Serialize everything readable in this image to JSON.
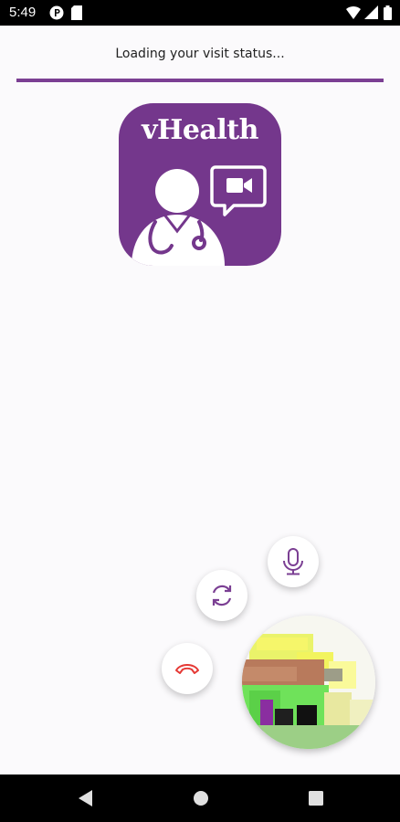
{
  "status_bar": {
    "time": "5:49",
    "icons": [
      "notification-p-icon",
      "sim-card-icon",
      "wifi-icon",
      "cellular-signal-icon",
      "battery-icon"
    ]
  },
  "loading": {
    "text": "Loading your visit status...",
    "progress_fraction": 1.0
  },
  "logo": {
    "text": "vHealth",
    "icon": "doctor-video-chat-icon",
    "color": "#74378c"
  },
  "controls": {
    "mute": {
      "icon": "microphone-icon"
    },
    "switch_camera": {
      "icon": "camera-switch-icon"
    },
    "end_call": {
      "icon": "hang-up-phone-icon",
      "color": "#e53935"
    },
    "self_view": {
      "icon": "self-view-video"
    }
  },
  "nav_bar": {
    "icons": [
      "back-icon",
      "home-icon",
      "recents-icon"
    ]
  },
  "colors": {
    "accent": "#74378c",
    "background": "#fbfafc",
    "end_call": "#e53935"
  }
}
